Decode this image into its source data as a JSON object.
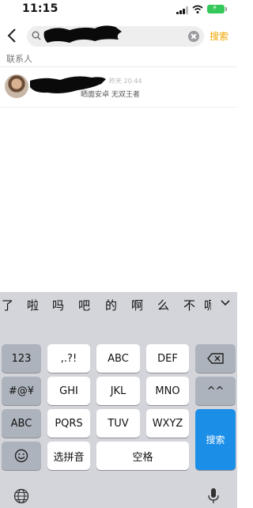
{
  "status_bar": {
    "time": "11:15",
    "battery_bolt": "⚡"
  },
  "search": {
    "query": "",
    "search_button": "搜索"
  },
  "section": {
    "contacts_label": "联系人"
  },
  "results": [
    {
      "time": "昨天 20:44",
      "preview": "晒面安卓 无双王者"
    }
  ],
  "keyboard": {
    "candidates": [
      "了",
      "啦",
      "吗",
      "吧",
      "的",
      "啊",
      "么",
      "不",
      "呢"
    ],
    "row1": [
      "123",
      ",.?!",
      "ABC",
      "DEF"
    ],
    "row2": [
      "#@¥",
      "GHI",
      "JKL",
      "MNO",
      "^^"
    ],
    "row3": [
      "ABC",
      "PQRS",
      "TUV",
      "WXYZ"
    ],
    "row4": [
      "选拼音",
      "空格"
    ],
    "search_key": "搜索",
    "icons": [
      "backspace-icon",
      "emoji-icon",
      "globe-icon",
      "mic-icon",
      "chevron-down-icon"
    ]
  },
  "colors": {
    "accent": "#f0a500",
    "search_key": "#1b8ee8",
    "keyboard_bg": "#d3d5db"
  }
}
